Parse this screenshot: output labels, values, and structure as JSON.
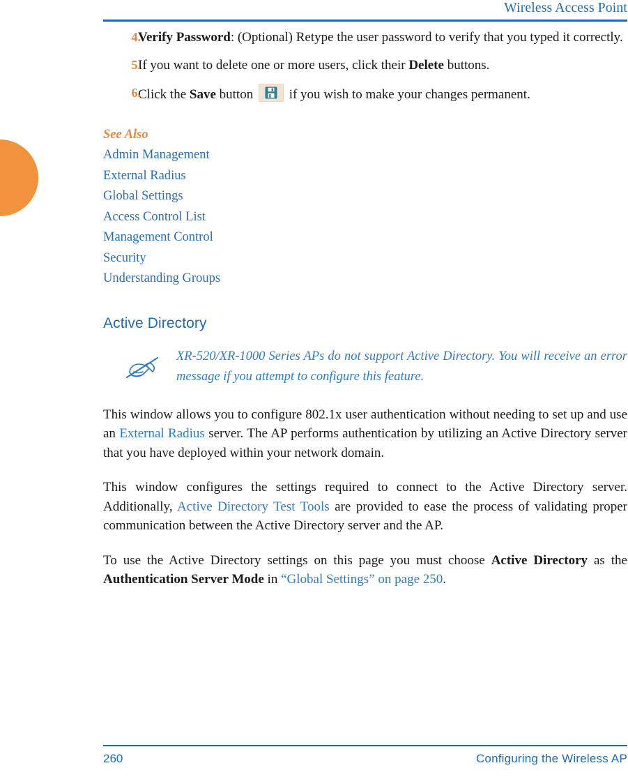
{
  "page": {
    "running_header": "Wireless Access Point",
    "footer_page_number": "260",
    "footer_section": "Configuring the Wireless AP",
    "accent_orange": "#E8883A",
    "accent_blue": "#1F6BB0",
    "link_blue": "#2F7BC4",
    "tab_orange": "#F2923D"
  },
  "steps": [
    {
      "number": "4.",
      "lead": "Verify Password",
      "text_after_lead": ": (Optional) Retype the user password to verify that you typed it correctly."
    },
    {
      "number": "5.",
      "text_before": "If you want to delete one or more users, click their ",
      "bold": "Delete",
      "text_after": " buttons."
    },
    {
      "number": "6.",
      "text_before": "Click the ",
      "bold": "Save",
      "text_mid": " button ",
      "icon": "save-floppy-icon",
      "text_after": " if you wish to make your changes permanent."
    }
  ],
  "see_also": {
    "title": "See Also",
    "links": [
      "Admin Management",
      "External Radius",
      "Global Settings",
      "Access Control List",
      "Management Control",
      "Security",
      "Understanding Groups"
    ]
  },
  "section": {
    "heading": "Active Directory",
    "note_icon": "note-pen-crossed-out-icon",
    "note_text": "XR-520/XR-1000 Series APs do not support Active Directory. You will receive an error message if you attempt to configure this feature.",
    "paragraphs": [
      {
        "id": "para-1",
        "parts": [
          {
            "kind": "text",
            "value": "This window allows you to configure 802.1x user authentication without needing to set up and use an "
          },
          {
            "kind": "link",
            "value": "External Radius"
          },
          {
            "kind": "text",
            "value": " server. The AP performs authentication by utilizing an Active Directory server that you have deployed within your network domain."
          }
        ]
      },
      {
        "id": "para-2",
        "parts": [
          {
            "kind": "text",
            "value": "This window configures the settings required to connect to the Active Directory server. Additionally, "
          },
          {
            "kind": "link",
            "value": "Active Directory Test Tools"
          },
          {
            "kind": "text",
            "value": " are provided to ease the process of validating proper communication between the Active Directory server and the AP."
          }
        ]
      },
      {
        "id": "para-3",
        "parts": [
          {
            "kind": "text",
            "value": "To use the Active Directory settings on this page you must choose "
          },
          {
            "kind": "bold",
            "value": "Active Directory"
          },
          {
            "kind": "text",
            "value": " as the "
          },
          {
            "kind": "bold",
            "value": "Authentication Server Mode"
          },
          {
            "kind": "text",
            "value": " in "
          },
          {
            "kind": "link",
            "value": "“Global Settings” on page 250"
          },
          {
            "kind": "text",
            "value": "."
          }
        ]
      }
    ]
  }
}
